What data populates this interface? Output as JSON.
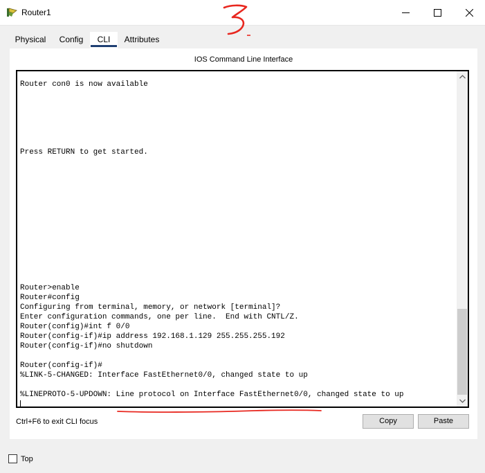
{
  "window": {
    "title": "Router1",
    "annotation_text": "3",
    "controls": [
      "minimize",
      "maximize",
      "close"
    ]
  },
  "tabs": [
    {
      "label": "Physical",
      "active": false
    },
    {
      "label": "Config",
      "active": false
    },
    {
      "label": "CLI",
      "active": true
    },
    {
      "label": "Attributes",
      "active": false
    }
  ],
  "cli": {
    "heading": "IOS Command Line Interface",
    "lines": [
      "Router con0 is now available",
      "",
      "",
      "",
      "",
      "",
      "",
      "Press RETURN to get started.",
      "",
      "",
      "",
      "",
      "",
      "",
      "",
      "",
      "",
      "",
      "",
      "",
      "",
      "Router>enable",
      "Router#config",
      "Configuring from terminal, memory, or network [terminal]?",
      "Enter configuration commands, one per line.  End with CNTL/Z.",
      "Router(config)#int f 0/0",
      "Router(config-if)#ip address 192.168.1.129 255.255.255.192",
      "Router(config-if)#no shutdown",
      "",
      "Router(config-if)#",
      "%LINK-5-CHANGED: Interface FastEthernet0/0, changed state to up",
      "",
      "%LINEPROTO-5-UPDOWN: Line protocol on Interface FastEthernet0/0, changed state to up"
    ],
    "hint": "Ctrl+F6 to exit CLI focus",
    "copy_label": "Copy",
    "paste_label": "Paste"
  },
  "footer": {
    "top_label": "Top",
    "top_checked": false
  },
  "colors": {
    "accent": "#1f3f73",
    "annotation": "#e8271f",
    "terminal_bg": "#ffffff",
    "window_bg": "#f0f0f0"
  }
}
